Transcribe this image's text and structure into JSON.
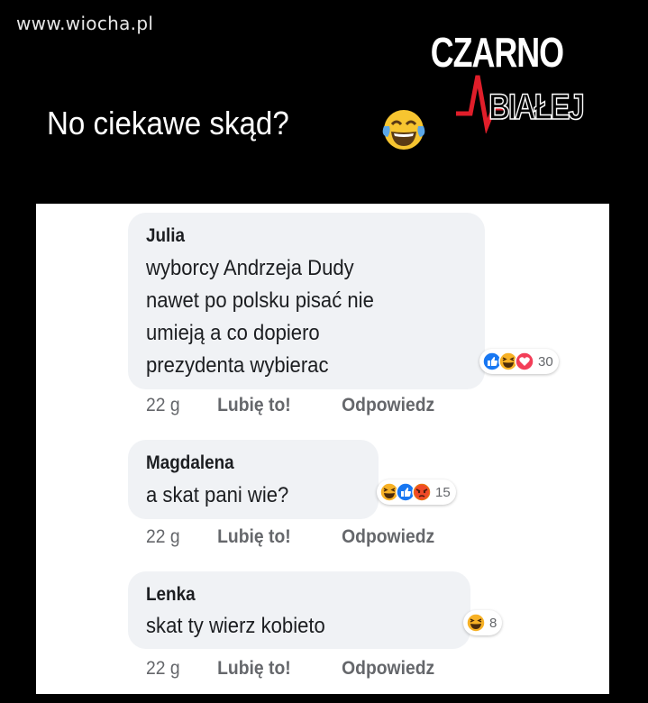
{
  "watermark": "www.wiocha.pl",
  "headline": "No ciekawe skąd?",
  "logo": {
    "line1": "CZARNO",
    "line2": "BIAŁEJ"
  },
  "colors": {
    "background": "#000000",
    "bubble": "#f0f2f5",
    "text": "#1c1e21",
    "meta": "#65676b",
    "like_blue": "#1877f2",
    "love_red": "#f33e58",
    "haha_yellow": "#f7b125",
    "angry_orange": "#e9710f",
    "logo_red": "#e01e2a"
  },
  "comments": [
    {
      "author": "Julia",
      "lines": [
        "wyborcy Andrzeja Dudy",
        "nawet po polsku pisać nie",
        "umieją a co dopiero",
        "prezydenta wybierac"
      ],
      "reactions": [
        "like-icon",
        "haha-icon",
        "love-icon"
      ],
      "reaction_count": "30",
      "age": "22 g",
      "like_label": "Lubię to!",
      "reply_label": "Odpowiedz"
    },
    {
      "author": "Magdalena",
      "lines": [
        "a skat pani wie?"
      ],
      "reactions": [
        "haha-icon",
        "like-icon",
        "angry-icon"
      ],
      "reaction_count": "15",
      "age": "22 g",
      "like_label": "Lubię to!",
      "reply_label": "Odpowiedz"
    },
    {
      "author": "Lenka",
      "lines": [
        "skat ty wierz kobieto"
      ],
      "reactions": [
        "haha-icon"
      ],
      "reaction_count": "8",
      "age": "22 g",
      "like_label": "Lubię to!",
      "reply_label": "Odpowiedz"
    }
  ]
}
